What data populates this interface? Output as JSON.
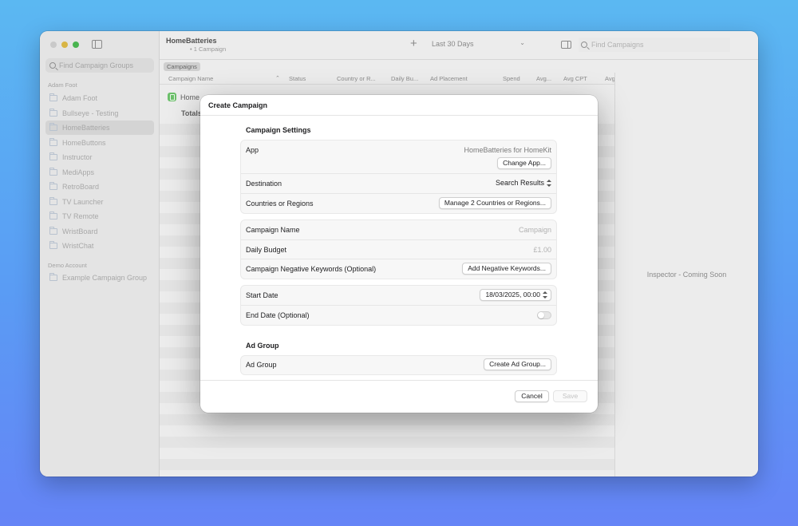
{
  "sidebar": {
    "search_placeholder": "Find Campaign Groups",
    "sections": [
      {
        "title": "Adam Foot",
        "items": [
          "Adam Foot",
          "Bullseye - Testing",
          "HomeBatteries",
          "HomeButtons",
          "Instructor",
          "MediApps",
          "RetroBoard",
          "TV Launcher",
          "TV Remote",
          "WristBoard",
          "WristChat"
        ]
      },
      {
        "title": "Demo Account",
        "items": [
          "Example Campaign Group"
        ]
      }
    ],
    "selected": "HomeBatteries"
  },
  "toolbar": {
    "title": "HomeBatteries",
    "subtitle": "1 Campaign",
    "add_icon": "plus-icon",
    "date_range": "Last 30 Days",
    "search_placeholder": "Find Campaigns"
  },
  "scope_tag": "Campaigns",
  "table": {
    "columns": [
      "Campaign Name",
      "Status",
      "Country or R...",
      "Daily Bu...",
      "Ad Placement",
      "Spend",
      "Avg...",
      "Avg CPT",
      "Avg"
    ],
    "rows": [
      {
        "name": "Home"
      }
    ],
    "totals_label": "Totals"
  },
  "inspector": {
    "placeholder": "Inspector - Coming Soon"
  },
  "dialog": {
    "title": "Create Campaign",
    "campaign_settings_title": "Campaign Settings",
    "app_label": "App",
    "app_value": "HomeBatteries for HomeKit",
    "change_app_button": "Change App...",
    "destination_label": "Destination",
    "destination_value": "Search Results",
    "countries_label": "Countries or Regions",
    "countries_button": "Manage 2 Countries or Regions...",
    "campaign_name_label": "Campaign Name",
    "campaign_name_placeholder": "Campaign",
    "daily_budget_label": "Daily Budget",
    "daily_budget_placeholder": "£1.00",
    "negative_keywords_label": "Campaign Negative Keywords (Optional)",
    "negative_keywords_button": "Add Negative Keywords...",
    "start_date_label": "Start Date",
    "start_date_value": "18/03/2025, 00:00",
    "end_date_label": "End Date (Optional)",
    "end_date_enabled": false,
    "ad_group_title": "Ad Group",
    "ad_group_label": "Ad Group",
    "ad_group_button": "Create Ad Group...",
    "cancel_button": "Cancel",
    "save_button": "Save"
  }
}
